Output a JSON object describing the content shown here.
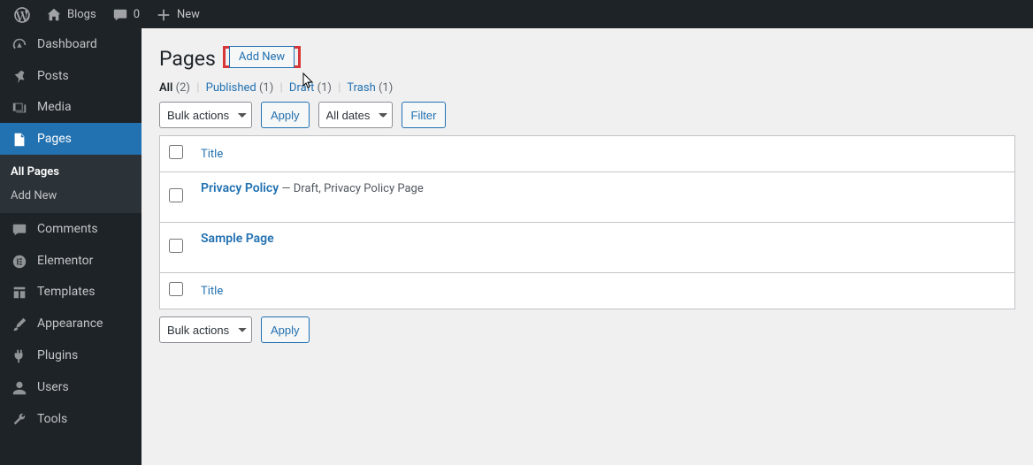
{
  "topbar": {
    "site_name": "Blogs",
    "comments_count": "0",
    "new_label": "New"
  },
  "sidebar": {
    "dashboard": "Dashboard",
    "posts": "Posts",
    "media": "Media",
    "pages": "Pages",
    "sub_all": "All Pages",
    "sub_add": "Add New",
    "comments": "Comments",
    "elementor": "Elementor",
    "templates": "Templates",
    "appearance": "Appearance",
    "plugins": "Plugins",
    "users": "Users",
    "tools": "Tools"
  },
  "page": {
    "title": "Pages",
    "add_new_label": "Add New"
  },
  "filters": {
    "all_label": "All",
    "all_count": "(2)",
    "published_label": "Published",
    "published_count": "(1)",
    "draft_label": "Draft",
    "draft_count": "(1)",
    "trash_label": "Trash",
    "trash_count": "(1)"
  },
  "controls": {
    "bulk_label": "Bulk actions",
    "apply_label": "Apply",
    "dates_label": "All dates",
    "filter_label": "Filter"
  },
  "table": {
    "col_title": "Title",
    "rows": [
      {
        "title": "Privacy Policy",
        "suffix": " — Draft, Privacy Policy Page"
      },
      {
        "title": "Sample Page",
        "suffix": ""
      }
    ]
  }
}
